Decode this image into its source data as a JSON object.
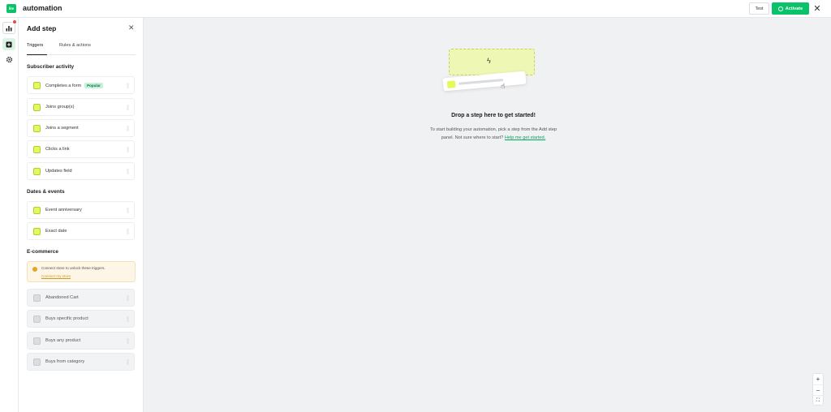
{
  "app": {
    "logo": "lite",
    "title": "automation"
  },
  "toolbar": {
    "test_label": "Test",
    "activate_label": "Activate",
    "close_glyph": "✕"
  },
  "rail": {
    "icons": [
      "chart-icon",
      "add-step-icon",
      "gear-icon"
    ],
    "notification": true
  },
  "panel": {
    "title": "Add step",
    "close_glyph": "✕",
    "tabs": [
      {
        "label": "Triggers",
        "active": true
      },
      {
        "label": "Rules & actions",
        "active": false
      }
    ],
    "sections": {
      "subscriber": {
        "title": "Subscriber activity",
        "items": [
          {
            "label": "Completes a form",
            "badge": "Popular",
            "icon": "form-icon"
          },
          {
            "label": "Joins group(s)",
            "icon": "group-icon"
          },
          {
            "label": "Joins a segment",
            "icon": "segment-icon"
          },
          {
            "label": "Clicks a link",
            "icon": "link-icon"
          },
          {
            "label": "Updates field",
            "icon": "refresh-icon"
          }
        ]
      },
      "dates": {
        "title": "Dates & events",
        "items": [
          {
            "label": "Event anniversary",
            "icon": "cake-icon"
          },
          {
            "label": "Exact date",
            "icon": "calendar-icon"
          }
        ]
      },
      "ecommerce": {
        "title": "E-commerce",
        "notice_text": "Connect store to unlock these triggers.",
        "notice_link": "Connect my store",
        "items": [
          {
            "label": "Abandoned Cart",
            "icon": "cart-icon"
          },
          {
            "label": "Buys specific product",
            "icon": "product-icon"
          },
          {
            "label": "Buys any product",
            "icon": "bag-icon"
          },
          {
            "label": "Buys from category",
            "icon": "category-icon"
          }
        ]
      }
    }
  },
  "canvas": {
    "title": "Drop a step here to get started!",
    "subtitle_line1": "To start building your automation, pick a step from the Add step",
    "subtitle_line2": "panel. Not sure where to start?",
    "help_link": "Help me get started."
  },
  "zoom": {
    "in": "+",
    "out": "−",
    "fit": "⛶"
  },
  "colors": {
    "brand": "#09c269",
    "accent_lime": "#e4f95c",
    "notice_bg": "#fdf6e6"
  }
}
